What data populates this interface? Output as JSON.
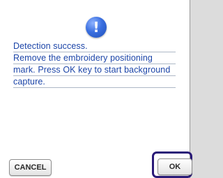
{
  "dialog": {
    "icon": "exclamation-icon",
    "icon_glyph": "!",
    "message_lines": [
      "Detection success.",
      "Remove the embroidery positioning",
      "mark. Press OK key to start background",
      "capture."
    ]
  },
  "buttons": {
    "cancel_label": "CANCEL",
    "ok_label": "OK"
  },
  "colors": {
    "message_text": "#1c45a8",
    "icon_blue": "#3a6fe0",
    "ok_highlight_frame": "#2a1a78"
  }
}
